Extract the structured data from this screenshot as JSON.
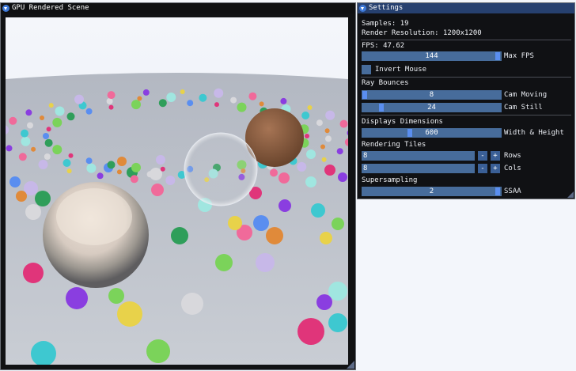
{
  "render_window": {
    "title": "GPU Rendered Scene",
    "scene_image": "path-traced-spheres-scene"
  },
  "settings": {
    "title": "Settings",
    "samples": "Samples: 19",
    "render_resolution": "Render Resolution: 1200x1200",
    "fps": "FPS: 47.62",
    "max_fps": {
      "value": "144",
      "label": "Max FPS",
      "fraction": 1.0
    },
    "invert_mouse": {
      "label": "Invert Mouse",
      "checked": false
    },
    "ray_bounces_header": "Ray Bounces",
    "cam_moving": {
      "value": "8",
      "label": "Cam Moving",
      "fraction": 0.0
    },
    "cam_still": {
      "value": "24",
      "label": "Cam Still",
      "fraction": 0.12
    },
    "display_dimensions_header": "Displays Dimensions",
    "width_height": {
      "value": "600",
      "label": "Width & Height",
      "fraction": 0.35
    },
    "rendering_tiles_header": "Rendering Tiles",
    "rows": {
      "value": "8",
      "label": "Rows",
      "minus": "-",
      "plus": "+"
    },
    "cols": {
      "value": "8",
      "label": "Cols",
      "minus": "-",
      "plus": "+"
    },
    "supersampling_header": "Supersampling",
    "ssaa": {
      "value": "2",
      "label": "SSAA",
      "fraction": 1.0
    }
  },
  "colors": {
    "titlebar_active": "#26406f",
    "frame_bg": "#476c9b",
    "slider_grab": "#5a8ef0",
    "window_bg": "#111214"
  }
}
